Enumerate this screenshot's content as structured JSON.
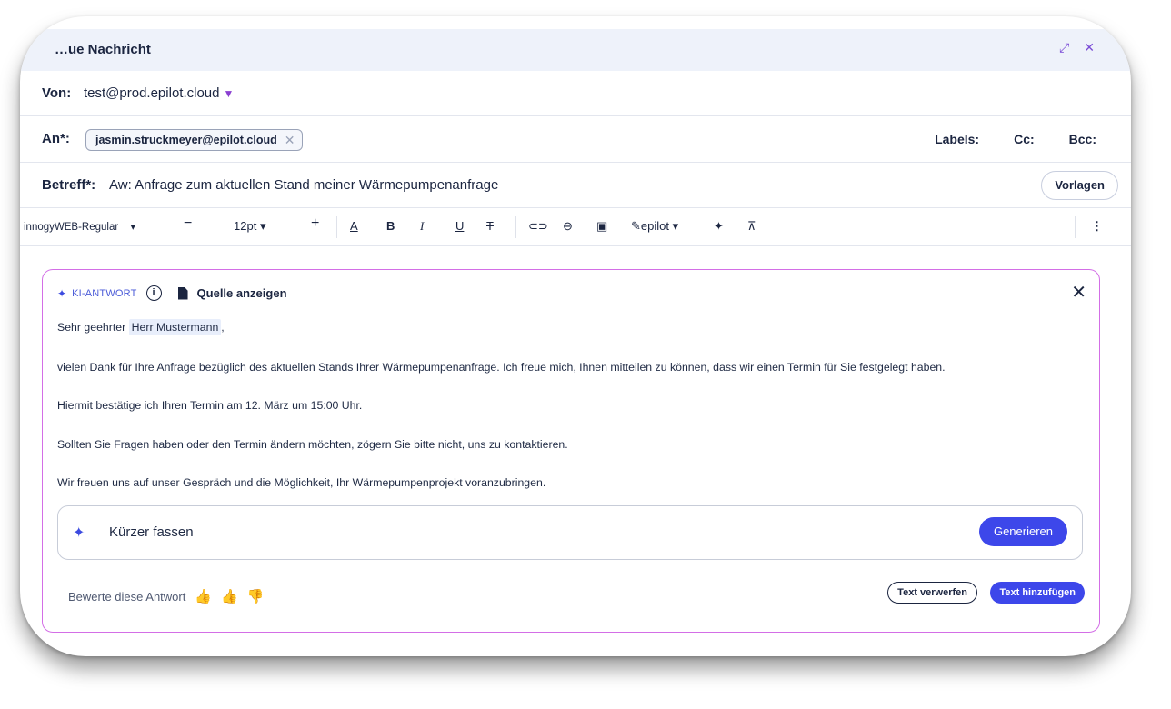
{
  "window": {
    "title": "…ue Nachricht",
    "expand_icon": "expand-icon",
    "close_icon": "close-icon"
  },
  "from": {
    "label": "Von:",
    "value": "test@prod.epilot.cloud"
  },
  "to": {
    "label": "An*:",
    "recipient": "jasmin.struckmeyer@epilot.cloud",
    "links": [
      "Labels:",
      "Cc:",
      "Bcc:"
    ]
  },
  "subject": {
    "label": "Betreff*:",
    "value": "Aw: Anfrage zum aktuellen Stand meiner Wärmepumpenanfrage",
    "templates_button": "Vorlagen"
  },
  "toolbar": {
    "font": "innogyWEB-Regular",
    "size": "12pt",
    "signature": "epilot"
  },
  "ai": {
    "tag": "KI-ANTWORT",
    "source_label": "Quelle anzeigen",
    "greeting_prefix": "Sehr geehrter",
    "greeting_name": "Herr Mustermann",
    "greeting_suffix": ",",
    "paragraphs": [
      "vielen Dank für Ihre Anfrage bezüglich des aktuellen Stands Ihrer Wärmepumpenanfrage. Ich freue mich, Ihnen mitteilen zu können, dass wir einen Termin für Sie festgelegt haben.",
      "Hiermit bestätige ich Ihren Termin am 12. März um 15:00 Uhr.",
      "Sollten Sie Fragen haben oder den Termin ändern möchten, zögern Sie bitte nicht, uns zu kontaktieren.",
      "Wir freuen uns auf unser Gespräch und die Möglichkeit, Ihr Wärmepumpenprojekt voranzubringen."
    ],
    "prompt_value": "Kürzer fassen",
    "generate_button": "Generieren",
    "rate_label": "Bewerte diese Antwort",
    "discard_button": "Text verwerfen",
    "add_button": "Text hinzufügen"
  },
  "colors": {
    "accent": "#3d47ea",
    "ai_border": "#d36ee6",
    "title_bg": "#eef2fa"
  }
}
